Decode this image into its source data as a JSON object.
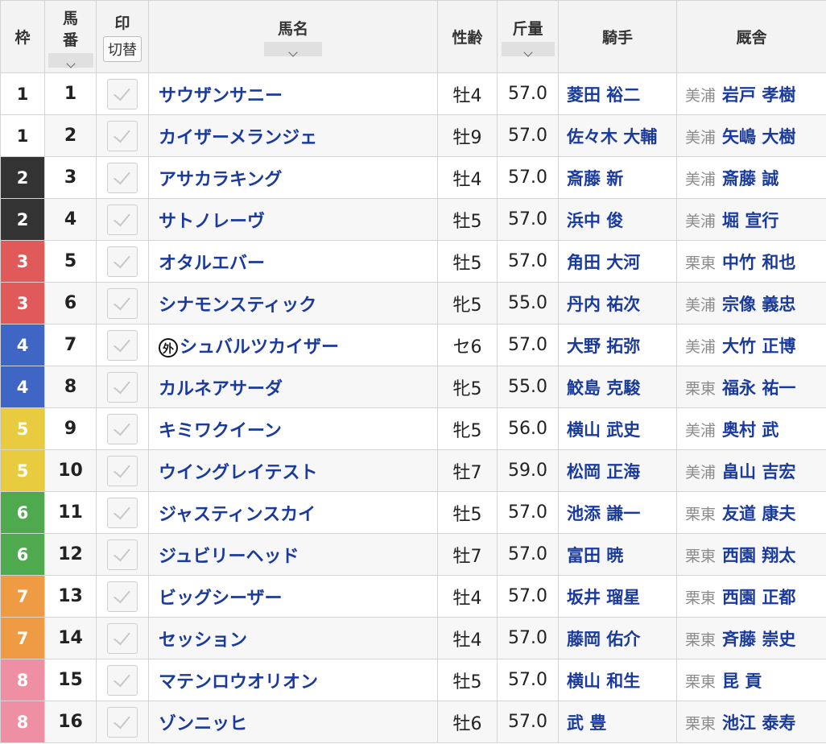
{
  "header": {
    "waku": "枠",
    "umaban_line1": "馬",
    "umaban_line2": "番",
    "mark": "印",
    "mark_toggle": "切替",
    "horse_name": "馬名",
    "sex_age": "性齢",
    "weight": "斤量",
    "jockey": "騎手",
    "stable": "厩舎"
  },
  "waku_colors": {
    "1": {
      "bg": "#ffffff",
      "fg": "#222222"
    },
    "2": {
      "bg": "#333333",
      "fg": "#ffffff"
    },
    "3": {
      "bg": "#e05a5a",
      "fg": "#ffffff"
    },
    "4": {
      "bg": "#3f66c4",
      "fg": "#ffffff"
    },
    "5": {
      "bg": "#e8cb3f",
      "fg": "#ffffff"
    },
    "6": {
      "bg": "#4faa4f",
      "fg": "#ffffff"
    },
    "7": {
      "bg": "#ef9b44",
      "fg": "#ffffff"
    },
    "8": {
      "bg": "#ef8fa3",
      "fg": "#ffffff"
    }
  },
  "rows": [
    {
      "waku": "1",
      "num": "1",
      "name": "サウザンサニー",
      "gaiji": "",
      "sex": "牡4",
      "weight": "57.0",
      "jockey": "菱田 裕二",
      "region": "美浦",
      "trainer": "岩戸 孝樹"
    },
    {
      "waku": "1",
      "num": "2",
      "name": "カイザーメランジェ",
      "gaiji": "",
      "sex": "牡9",
      "weight": "57.0",
      "jockey": "佐々木 大輔",
      "region": "美浦",
      "trainer": "矢嶋 大樹"
    },
    {
      "waku": "2",
      "num": "3",
      "name": "アサカラキング",
      "gaiji": "",
      "sex": "牡4",
      "weight": "57.0",
      "jockey": "斎藤 新",
      "region": "美浦",
      "trainer": "斎藤 誠"
    },
    {
      "waku": "2",
      "num": "4",
      "name": "サトノレーヴ",
      "gaiji": "",
      "sex": "牡5",
      "weight": "57.0",
      "jockey": "浜中 俊",
      "region": "美浦",
      "trainer": "堀 宣行"
    },
    {
      "waku": "3",
      "num": "5",
      "name": "オタルエバー",
      "gaiji": "",
      "sex": "牡5",
      "weight": "57.0",
      "jockey": "角田 大河",
      "region": "栗東",
      "trainer": "中竹 和也"
    },
    {
      "waku": "3",
      "num": "6",
      "name": "シナモンスティック",
      "gaiji": "",
      "sex": "牝5",
      "weight": "55.0",
      "jockey": "丹内 祐次",
      "region": "美浦",
      "trainer": "宗像 義忠"
    },
    {
      "waku": "4",
      "num": "7",
      "name": "シュバルツカイザー",
      "gaiji": "外",
      "sex": "セ6",
      "weight": "57.0",
      "jockey": "大野 拓弥",
      "region": "美浦",
      "trainer": "大竹 正博"
    },
    {
      "waku": "4",
      "num": "8",
      "name": "カルネアサーダ",
      "gaiji": "",
      "sex": "牝5",
      "weight": "55.0",
      "jockey": "鮫島 克駿",
      "region": "栗東",
      "trainer": "福永 祐一"
    },
    {
      "waku": "5",
      "num": "9",
      "name": "キミワクイーン",
      "gaiji": "",
      "sex": "牝5",
      "weight": "56.0",
      "jockey": "横山 武史",
      "region": "美浦",
      "trainer": "奥村 武"
    },
    {
      "waku": "5",
      "num": "10",
      "name": "ウイングレイテスト",
      "gaiji": "",
      "sex": "牡7",
      "weight": "59.0",
      "jockey": "松岡 正海",
      "region": "美浦",
      "trainer": "畠山 吉宏"
    },
    {
      "waku": "6",
      "num": "11",
      "name": "ジャスティンスカイ",
      "gaiji": "",
      "sex": "牡5",
      "weight": "57.0",
      "jockey": "池添 謙一",
      "region": "栗東",
      "trainer": "友道 康夫"
    },
    {
      "waku": "6",
      "num": "12",
      "name": "ジュビリーヘッド",
      "gaiji": "",
      "sex": "牡7",
      "weight": "57.0",
      "jockey": "富田 暁",
      "region": "栗東",
      "trainer": "西園 翔太"
    },
    {
      "waku": "7",
      "num": "13",
      "name": "ビッグシーザー",
      "gaiji": "",
      "sex": "牡4",
      "weight": "57.0",
      "jockey": "坂井 瑠星",
      "region": "栗東",
      "trainer": "西園 正都"
    },
    {
      "waku": "7",
      "num": "14",
      "name": "セッション",
      "gaiji": "",
      "sex": "牡4",
      "weight": "57.0",
      "jockey": "藤岡 佑介",
      "region": "栗東",
      "trainer": "斉藤 崇史"
    },
    {
      "waku": "8",
      "num": "15",
      "name": "マテンロウオリオン",
      "gaiji": "",
      "sex": "牡5",
      "weight": "57.0",
      "jockey": "横山 和生",
      "region": "栗東",
      "trainer": "昆 貢"
    },
    {
      "waku": "8",
      "num": "16",
      "name": "ゾンニッヒ",
      "gaiji": "",
      "sex": "牡6",
      "weight": "57.0",
      "jockey": "武 豊",
      "region": "栗東",
      "trainer": "池江 泰寿"
    }
  ]
}
